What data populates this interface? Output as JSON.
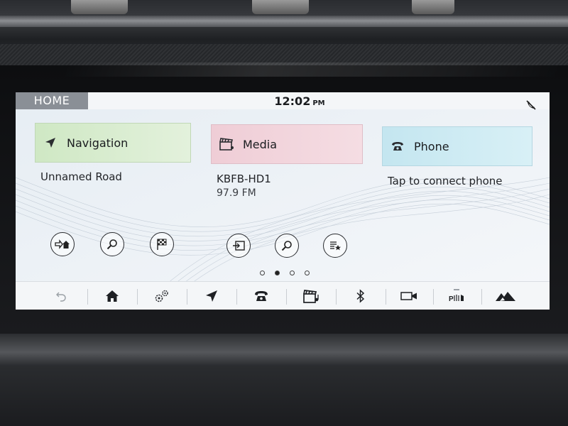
{
  "status": {
    "home_label": "HOME",
    "time": "12:02",
    "ampm": "PM"
  },
  "tiles": {
    "navigation": {
      "label": "Navigation",
      "subtitle": "Unnamed Road",
      "icon": "navigation-arrow-icon"
    },
    "media": {
      "label": "Media",
      "station": "KBFB-HD1",
      "frequency": "97.9 FM",
      "icon": "clapperboard-icon"
    },
    "phone": {
      "label": "Phone",
      "subtitle": "Tap to connect phone",
      "icon": "telephone-icon"
    }
  },
  "shortcuts": {
    "navigation": [
      "go-home-icon",
      "search-icon",
      "destination-flag-icon"
    ],
    "media": [
      "source-select-icon",
      "search-icon",
      "favourites-list-icon"
    ]
  },
  "pages": {
    "count": 4,
    "active_index": 1
  },
  "toolbar": {
    "items": [
      "back-icon",
      "home-icon",
      "settings-icon",
      "navigation-icon",
      "phone-icon",
      "media-icon",
      "bluetooth-icon",
      "camera-icon",
      "parking-aid-icon",
      "terrain-response-icon"
    ]
  },
  "colors": {
    "home_tab": "#8a8f96",
    "navigation_tile": "#cfe8c4",
    "media_tile": "#efcdd6",
    "phone_tile": "#c4e6f0"
  }
}
